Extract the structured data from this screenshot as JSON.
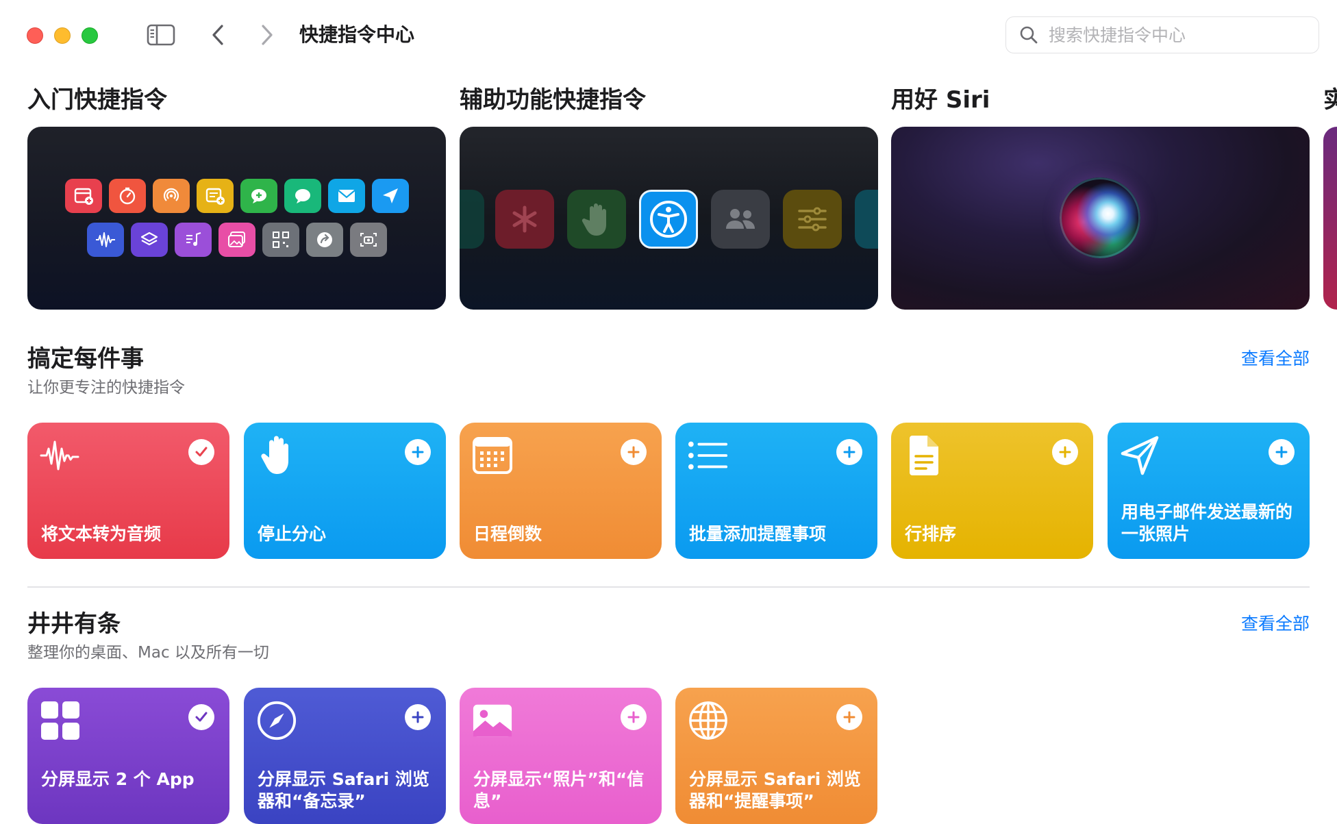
{
  "window": {
    "title": "快捷指令中心"
  },
  "search": {
    "placeholder": "搜索快捷指令中心",
    "value": ""
  },
  "featured": [
    {
      "title": "入门快捷指令"
    },
    {
      "title": "辅助功能快捷指令"
    },
    {
      "title": "用好 Siri"
    },
    {
      "title": "实"
    }
  ],
  "sections": [
    {
      "title": "搞定每件事",
      "subtitle": "让你更专注的快捷指令",
      "see_all": "查看全部",
      "cards": [
        {
          "label": "将文本转为音频",
          "icon": "waveform-icon",
          "state": "added",
          "color": "#e9434f"
        },
        {
          "label": "停止分心",
          "icon": "hand-raised-icon",
          "state": "add",
          "color": "#12a5f3"
        },
        {
          "label": "日程倒数",
          "icon": "calendar-icon",
          "state": "add",
          "color": "#f29840"
        },
        {
          "label": "批量添加提醒事项",
          "icon": "list-bullet-icon",
          "state": "add",
          "color": "#12a5f3"
        },
        {
          "label": "行排序",
          "icon": "document-icon",
          "state": "add",
          "color": "#e8ba15"
        },
        {
          "label": "用电子邮件发送最新的一张照片",
          "icon": "paperplane-icon",
          "state": "add",
          "color": "#12a5f3"
        }
      ]
    },
    {
      "title": "井井有条",
      "subtitle": "整理你的桌面、Mac 以及所有一切",
      "see_all": "查看全部",
      "cards": [
        {
          "label": "分屏显示 2 个 App",
          "icon": "grid-icon",
          "state": "added",
          "color": "#7a3fcb"
        },
        {
          "label": "分屏显示 Safari 浏览器和“备忘录”",
          "icon": "compass-icon",
          "state": "add",
          "color": "#434ecb"
        },
        {
          "label": "分屏显示“照片”和“信息”",
          "icon": "photo-icon",
          "state": "add",
          "color": "#ec6cd3"
        },
        {
          "label": "分屏显示 Safari 浏览器和“提醒事项”",
          "icon": "globe-icon",
          "state": "add",
          "color": "#f29840"
        }
      ]
    }
  ],
  "colors": {
    "accent": "#0a7aff"
  }
}
